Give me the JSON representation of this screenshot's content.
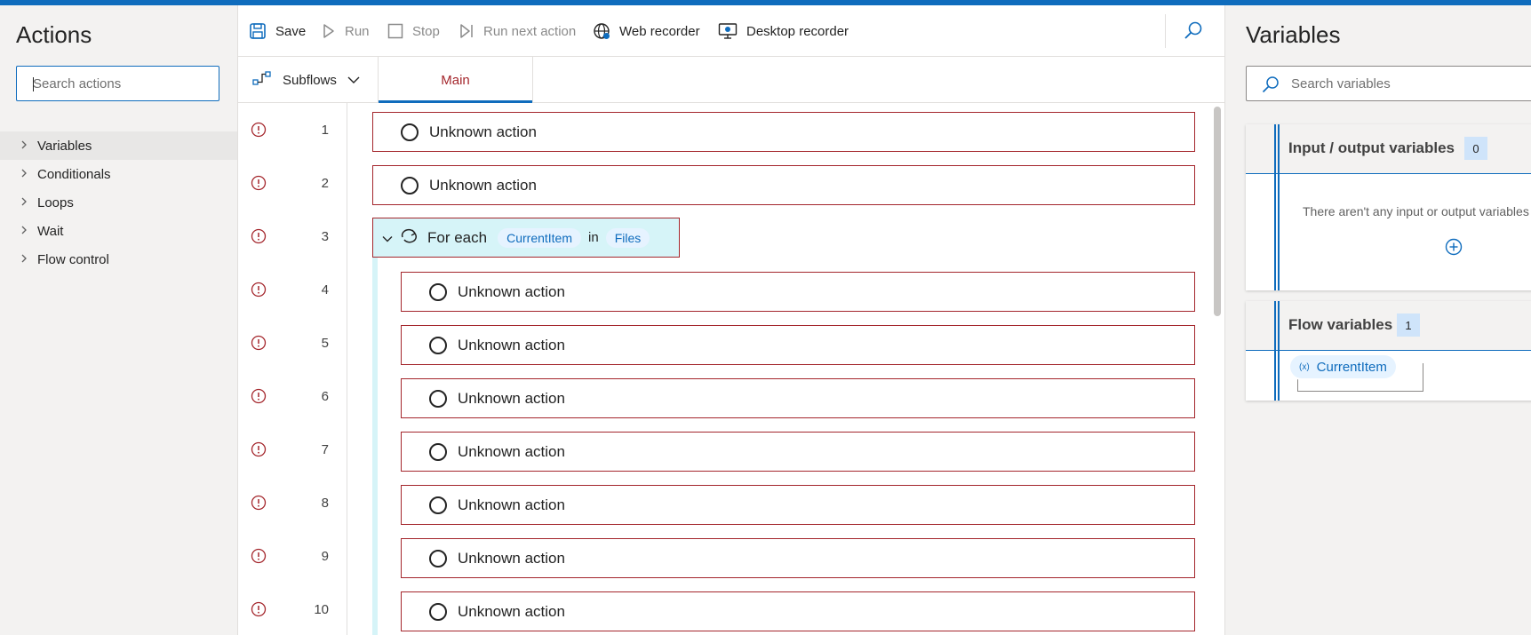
{
  "actions_pane": {
    "title": "Actions",
    "search_placeholder": "Search actions",
    "categories": [
      {
        "label": "Variables"
      },
      {
        "label": "Conditionals"
      },
      {
        "label": "Loops"
      },
      {
        "label": "Wait"
      },
      {
        "label": "Flow control"
      }
    ]
  },
  "toolbar": {
    "save_label": "Save",
    "run_label": "Run",
    "stop_label": "Stop",
    "run_next_label": "Run next action",
    "web_recorder_label": "Web recorder",
    "desktop_recorder_label": "Desktop recorder"
  },
  "tabs": {
    "subflows_label": "Subflows",
    "main_label": "Main"
  },
  "flow": {
    "rows": [
      {
        "num": "1",
        "label": "Unknown action"
      },
      {
        "num": "2",
        "label": "Unknown action"
      },
      {
        "num": "3",
        "label": "For each",
        "var": "CurrentItem",
        "kw": "in",
        "list": "Files"
      },
      {
        "num": "4",
        "label": "Unknown action"
      },
      {
        "num": "5",
        "label": "Unknown action"
      },
      {
        "num": "6",
        "label": "Unknown action"
      },
      {
        "num": "7",
        "label": "Unknown action"
      },
      {
        "num": "8",
        "label": "Unknown action"
      },
      {
        "num": "9",
        "label": "Unknown action"
      },
      {
        "num": "10",
        "label": "Unknown action"
      }
    ]
  },
  "variables_pane": {
    "title": "Variables",
    "search_placeholder": "Search variables",
    "io_section": {
      "title": "Input / output variables",
      "count": "0",
      "empty_message": "There aren't any input or output variables"
    },
    "flow_section": {
      "title": "Flow variables",
      "count": "1",
      "items": [
        {
          "name": "CurrentItem",
          "icon": "(x)"
        }
      ]
    }
  },
  "colors": {
    "accent": "#0f6cbd",
    "error": "#a4262c",
    "loop_bg": "#d6f4f8"
  }
}
